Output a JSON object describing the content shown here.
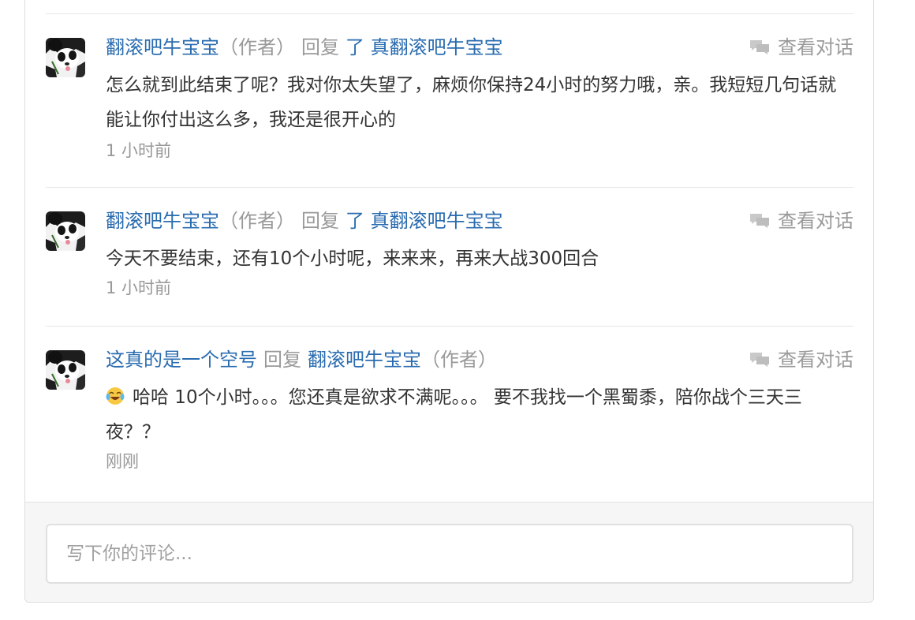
{
  "comments": [
    {
      "author": "翻滚吧牛宝宝",
      "author_tag": "（作者）",
      "reply_word": "回复",
      "reply_to": "了 真翻滚吧牛宝宝",
      "reply_to_tag": "",
      "view_dialog": "查看对话",
      "emoji": "",
      "text": "怎么就到此结束了呢？我对你太失望了，麻烦你保持24小时的努力哦，亲。我短短几句话就能让你付出这么多，我还是很开心的",
      "time": "1 小时前"
    },
    {
      "author": "翻滚吧牛宝宝",
      "author_tag": "（作者）",
      "reply_word": "回复",
      "reply_to": "了 真翻滚吧牛宝宝",
      "reply_to_tag": "",
      "view_dialog": "查看对话",
      "emoji": "",
      "text": "今天不要结束，还有10个小时呢，来来来，再来大战300回合",
      "time": "1 小时前"
    },
    {
      "author": "这真的是一个空号",
      "author_tag": "",
      "reply_word": "回复",
      "reply_to": "翻滚吧牛宝宝",
      "reply_to_tag": "（作者）",
      "view_dialog": "查看对话",
      "emoji": "laughing-tears-emoji",
      "text": "哈哈 10个小时。。。您还真是欲求不满呢。。。 要不我找一个黑蜀黍，陪你战个三天三夜？？",
      "time": "刚刚"
    }
  ],
  "comment_box": {
    "placeholder": "写下你的评论..."
  },
  "icons": {
    "view_dialog_icon": "chat-bubbles-icon",
    "avatar": "panda-avatar"
  },
  "colors": {
    "link": "#2a6cb0",
    "muted": "#999999",
    "text": "#333333"
  }
}
